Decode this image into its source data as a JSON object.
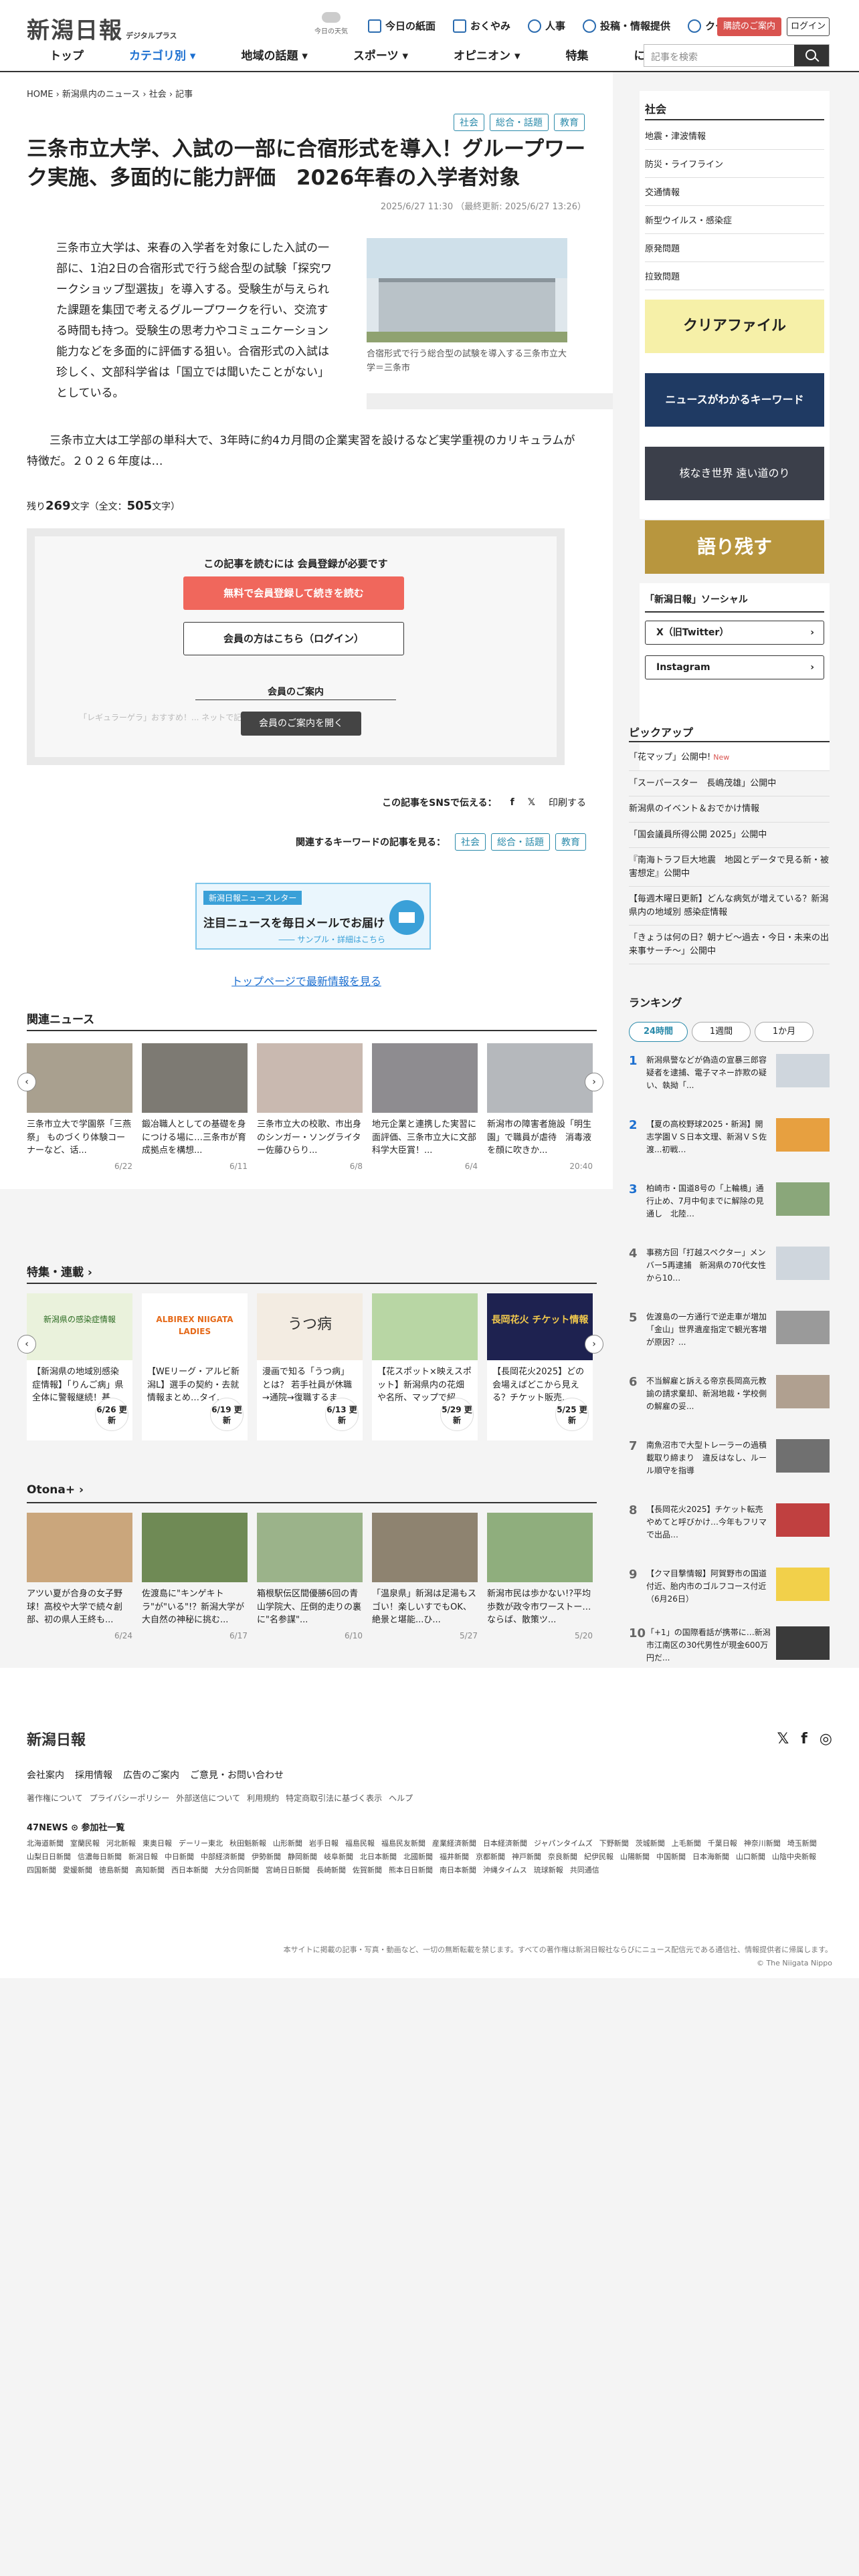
{
  "header": {
    "logo": "新潟日報",
    "logo_sub": "デジタルプラス",
    "weather": "今日の天気",
    "links": [
      "今日の紙面",
      "おくやみ",
      "人事",
      "投稿・情報提供",
      "クーポン"
    ],
    "guide_btn": "購読のご案内",
    "login_btn": "ログイン",
    "nav": [
      "トップ",
      "カテゴリ別 ▾",
      "地域の話題 ▾",
      "スポーツ ▾",
      "オピニオン ▾",
      "特集",
      "にいがたナビ"
    ],
    "search_placeholder": "記事を検索"
  },
  "article": {
    "breadcrumb": "HOME  ›  新潟県内のニュース  ›  社会  ›  記事",
    "tags": [
      "社会",
      "総合・話題",
      "教育"
    ],
    "title": "三条市立大学、入試の一部に合宿形式を導入！グループワーク実施、多面的に能力評価　2026年春の入学者対象",
    "date": "2025/6/27 11:30 （最終更新: 2025/6/27 13:26）",
    "body1": "三条市立大学は、来春の入学者を対象にした入試の一部に、1泊2日の合宿形式で行う総合型の試験「探究ワークショップ型選抜」を導入する。受験生が与えられた課題を集団で考えるグループワークを行い、交流する時間も持つ。受験生の思考力やコミュニケーション能力などを多面的に評価する狙い。合宿形式の入試は珍しく、文部科学省は「国立では聞いたことがない」としている。",
    "caption": "合宿形式で行う総合型の試験を導入する三条市立大学＝三条市",
    "body2": "三条市立大は工学部の単科大で、3年時に約4カ月間の企業実習を設けるなど実学重視のカリキュラムが特徴だ。２０２６年度は…",
    "remain_label": "残り",
    "remain_num": "269",
    "remain_unit": "文字（全文：",
    "total_num": "505",
    "total_unit": "文字）"
  },
  "paywall": {
    "heading": "この記事を読むには 会員登録が必要です",
    "free_btn": "無料で会員登録して続きを読む",
    "member_btn": "会員の方はこちら（ログイン）",
    "guide_title": "会員のご案内",
    "faded": "「レギュラーゲラ」おすすめ！... ネットで記事が読み放題！ ほか",
    "open_btn": "会員のご案内を開く"
  },
  "share": {
    "label": "この記事をSNSで伝える：",
    "fb": "f",
    "x": "𝕏",
    "print": "印刷する"
  },
  "keywords": {
    "label": "関連するキーワードの記事を見る：",
    "items": [
      "社会",
      "総合・話題",
      "教育"
    ]
  },
  "newsletter": {
    "tag": "新潟日報ニュースレター",
    "title": "注目ニュースを毎日メールでお届け",
    "link": "―― サンプル・詳細はこちら"
  },
  "toplink": "トップページで最新情報を見る",
  "related": {
    "title": "関連ニュース",
    "items": [
      {
        "text": "三条市立大で学園祭「三燕祭」 ものづくり体験コーナーなど、话...",
        "date": "6/22"
      },
      {
        "text": "鍛冶職人としての基礎を身につける場に…三条市が育成拠点を構想...",
        "date": "6/11"
      },
      {
        "text": "三条市立大の校歌、市出身のシンガー・ソングライター佐藤ひらり...",
        "date": "6/8"
      },
      {
        "text": "地元企業と連携した実習に面評価、三条市立大に文部科学大臣賞！...",
        "date": "6/4"
      },
      {
        "text": "新潟市の障害者施設「明生園」で職員が虐待　消毒液を顔に吹きか...",
        "date": "20:40"
      }
    ]
  },
  "features": {
    "title": "特集・連載 ›",
    "items": [
      {
        "text": "【新潟県の地域別感染症情報】「りんご病」県全体に警報継続！基...",
        "badge": "6/26 更新",
        "img": "新潟県の感染症情報"
      },
      {
        "text": "【WEリーグ・アルビ新潟L】選手の契約・去就情報まとめ…タイ...",
        "badge": "6/19 更新",
        "img": "ALBIREX NIIGATA LADIES"
      },
      {
        "text": "漫画で知る「うつ病」とは？ 若手社員が休職→通院→復職するま...",
        "badge": "6/13 更新",
        "img": "うつ病"
      },
      {
        "text": "【花スポット×映えスポット】新潟県内の花畑や名所、マップで紹...",
        "badge": "5/29 更新",
        "img": ""
      },
      {
        "text": "【長岡花火2025】どの会場えばどこから見える？チケット販売...",
        "badge": "5/25 更新",
        "img": "長岡花火 チケット情報"
      }
    ]
  },
  "otona": {
    "title": "Otona+ ›",
    "items": [
      {
        "text": "アツい夏が合身の女子野球！高校や大学で続々創部、初の県人王終も...",
        "date": "6/24"
      },
      {
        "text": "佐渡島に\"キンゲキトラ\"が\"いる\"!？新潟大学が大自然の神秘に挑む...",
        "date": "6/17"
      },
      {
        "text": "箱根駅伝区間優勝6回の青山学院大、圧倒的走りの裏に\"名参謀\"...",
        "date": "6/10"
      },
      {
        "text": "「温泉県」新潟は足湯もスゴい！楽しいすでもOK、絶景と堪能...ひ...",
        "date": "5/27"
      },
      {
        "text": "新潟市民は歩かない!?平均歩数が政令市ワーストー…ならば、散策ツ...",
        "date": "5/20"
      }
    ]
  },
  "sidebar": {
    "cat_title": "社会",
    "cats": [
      "地震・津波情報",
      "防災・ライフライン",
      "交通情報",
      "新型ウイルス・感染症",
      "原発問題",
      "拉致問題"
    ],
    "banners": [
      "クリアファイル",
      "ニュースがわかるキーワード",
      "核なき世界 遠い道のり",
      "語り残す"
    ],
    "social_title": "「新潟日報」ソーシャル",
    "social": [
      "X（旧Twitter）",
      "Instagram"
    ],
    "pickup_title": "ピックアップ",
    "pickup": [
      "「花マップ」公開中!",
      "「スーパースター　長嶋茂雄」公開中",
      "新潟県のイベント＆おでかけ情報",
      "「国会議員所得公開 2025」公開中",
      "『南海トラフ巨大地震　地図とデータで見る新・被害想定』公開中",
      "【毎週木曜日更新】どんな病気が増えている？新潟県内の地域別 感染症情報",
      "「きょうは何の日？朝ナビ〜過去・今日・未来の出来事サーチ〜」公開中"
    ],
    "pickup_new": "New",
    "ranking_title": "ランキング",
    "ranking_tabs": [
      "24時間",
      "1週間",
      "1か月"
    ],
    "ranking": [
      "新潟県警などが偽造の宣暴三郎容疑者を逮捕、電子マネー詐欺の疑い、執拗「...",
      "【夏の高校野球2025・新潟】開志学園ＶＳ日本文理、新潟ＶＳ佐渡...初戦…",
      "柏崎市・国道8号の「上輪橋」通行止め、7月中旬までに解除の見通し　北陸…",
      "事務方回「打越スペクター」メンバー5再逮捕　新潟県の70代女性から10…",
      "佐渡島の一方通行で逆走車が増加「金山」世界遺産指定で観光客増が原因？...",
      "不当解雇と訴える帝京長岡高元教諭の請求棄却、新潟地裁・学校側の解雇の妥...",
      "南魚沼市で大型トレーラーの過積載取り締まり　違反はなし、ルール順守を指導",
      "【長岡花火2025】チケット転売やめてと呼びかけ…今年もフリマで出品…",
      "【クマ目撃情報】阿賀野市の国道付近、胎内市のゴルフコース付近（6月26日）",
      "「+1」の国際看話が携帯に…新潟市江南区の30代男性が現金600万円だ..."
    ]
  },
  "footer": {
    "logo": "新潟日報",
    "links": [
      "会社案内",
      "採用情報",
      "広告のご案内",
      "ご意見・お問い合わせ"
    ],
    "small": [
      "著作権について",
      "プライバシーポリシー",
      "外部送信について",
      "利用規約",
      "特定商取引法に基づく表示",
      "ヘルプ"
    ],
    "news47": "47NEWS ⊙ 参加社一覧",
    "papers": [
      "北海道新聞",
      "室蘭民報",
      "河北新報",
      "東奥日報",
      "デーリー東北",
      "秋田魁新報",
      "山形新聞",
      "岩手日報",
      "福島民報",
      "福島民友新聞",
      "産業経済新聞",
      "日本経済新聞",
      "ジャパンタイムズ",
      "下野新聞",
      "茨城新聞",
      "上毛新聞",
      "千葉日報",
      "神奈川新聞",
      "埼玉新聞",
      "山梨日日新聞",
      "信濃毎日新聞",
      "新潟日報",
      "中日新聞",
      "中部経済新聞",
      "伊勢新聞",
      "静岡新聞",
      "岐阜新聞",
      "北日本新聞",
      "北國新聞",
      "福井新聞",
      "京都新聞",
      "神戸新聞",
      "奈良新聞",
      "紀伊民報",
      "山陽新聞",
      "中国新聞",
      "日本海新聞",
      "山口新聞",
      "山陰中央新報",
      "四国新聞",
      "愛媛新聞",
      "徳島新聞",
      "高知新聞",
      "西日本新聞",
      "大分合同新聞",
      "宮崎日日新聞",
      "長崎新聞",
      "佐賀新聞",
      "熊本日日新聞",
      "南日本新聞",
      "沖縄タイムス",
      "琉球新報",
      "共同通信"
    ],
    "copyright": "本サイトに掲載の記事・写真・動画など、一切の無断転載を禁じます。すべての著作権は新潟日報社ならびにニュース配信元である通信社、情報提供者に帰属します。",
    "copyright2": "© The Niigata Nippo"
  }
}
